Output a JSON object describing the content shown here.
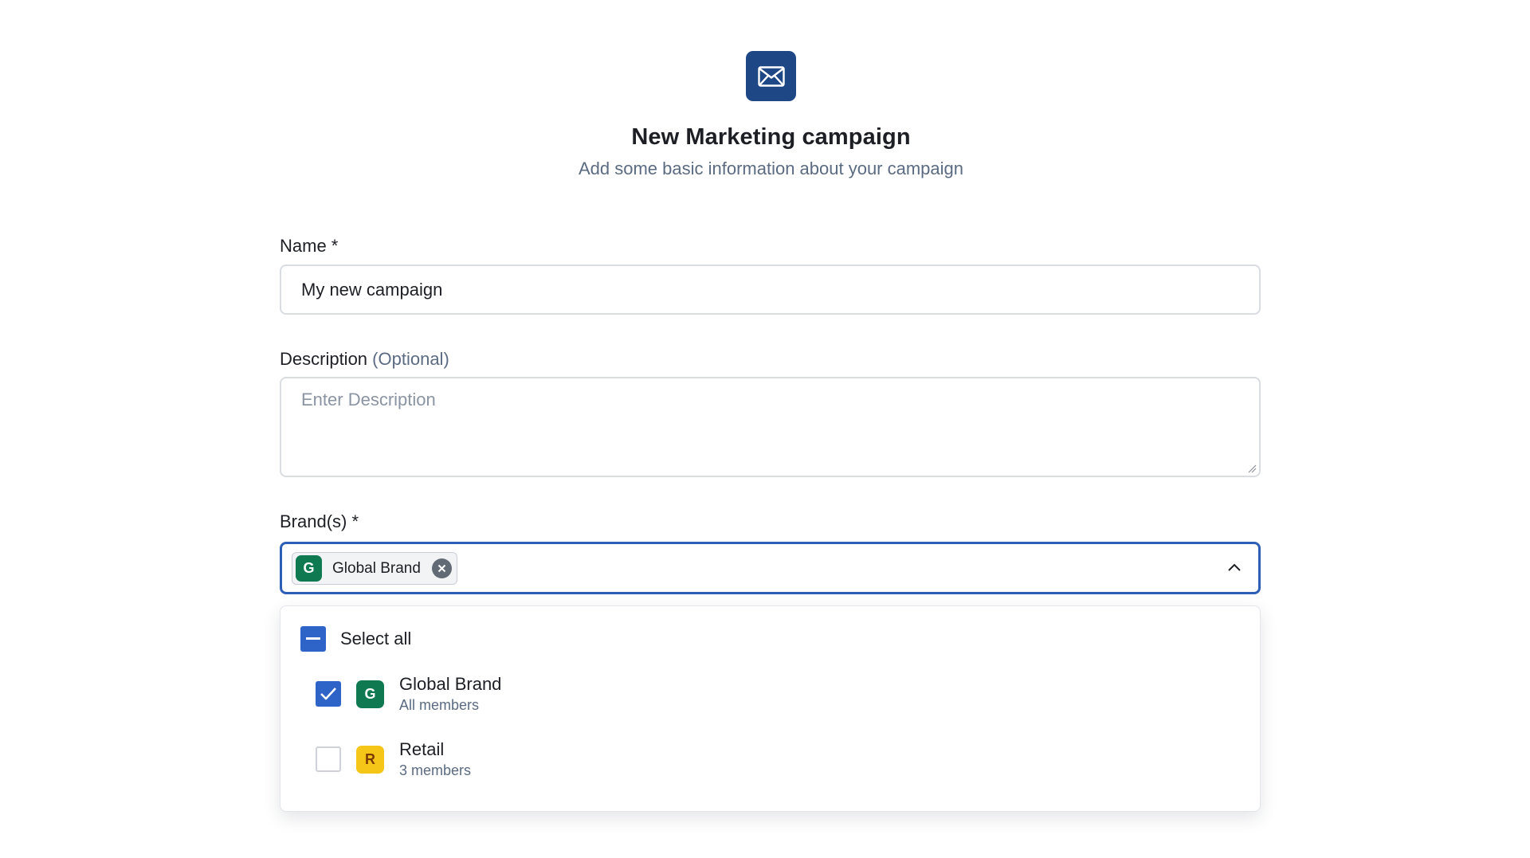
{
  "header": {
    "icon": "mail-icon",
    "title": "New Marketing campaign",
    "subtitle": "Add some basic information about your campaign"
  },
  "form": {
    "name": {
      "label": "Name *",
      "value": "My new campaign"
    },
    "description": {
      "label": "Description",
      "optional_label": "(Optional)",
      "placeholder": "Enter Description",
      "value": ""
    },
    "brands": {
      "label": "Brand(s) *",
      "selected_chips": [
        {
          "label": "Global Brand",
          "initial": "G",
          "color": "#0f7a52"
        }
      ],
      "expanded": true,
      "dropdown": {
        "select_all_label": "Select all",
        "select_all_state": "indeterminate",
        "options": [
          {
            "name": "Global Brand",
            "subtitle": "All members",
            "initial": "G",
            "avatar_color": "#0f7a52",
            "avatar_text_color": "#ffffff",
            "checked": true
          },
          {
            "name": "Retail",
            "subtitle": "3 members",
            "initial": "R",
            "avatar_color": "#f5c518",
            "avatar_text_color": "#7a3b00",
            "checked": false
          }
        ]
      }
    }
  },
  "colors": {
    "accent": "#2e63c8",
    "header_icon_bg": "#1e4785",
    "focus_border": "#2d5fb6"
  }
}
